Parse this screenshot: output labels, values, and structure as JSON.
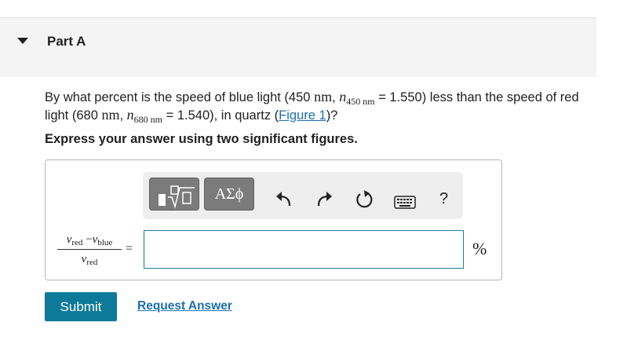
{
  "part": {
    "title": "Part A"
  },
  "question": {
    "t1": "By what percent is the speed of blue light (450",
    "nm": "nm",
    "n": "n",
    "sub_blue": "450 nm",
    "t2": "= 1.550) less than the speed of red light (680",
    "sub_red": "680 nm",
    "t3": "= 1.540), in quartz (",
    "figure_link": "Figure 1",
    "t4": ")?"
  },
  "instruction": "Express your answer using two significant figures.",
  "toolbar": {
    "greek_label": "ΑΣϕ",
    "help_label": "?"
  },
  "expression": {
    "v": "v",
    "red": "red",
    "minus": "−",
    "blue": "blue",
    "equals": "="
  },
  "answer": {
    "value": "",
    "placeholder": "",
    "unit": "%"
  },
  "actions": {
    "submit": "Submit",
    "request": "Request Answer"
  }
}
